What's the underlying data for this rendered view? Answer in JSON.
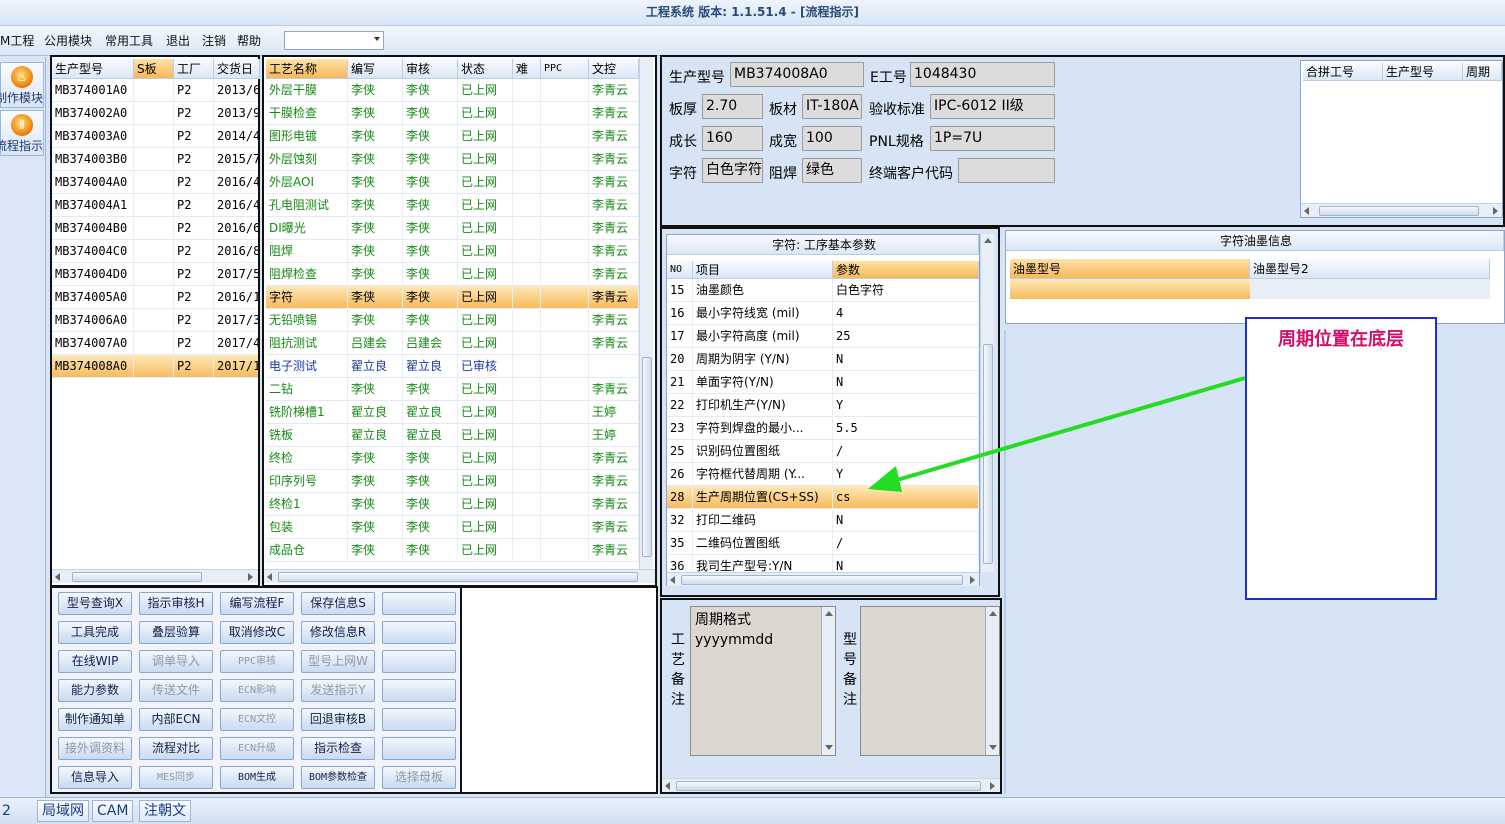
{
  "window": {
    "title": "工程系统  版本: 1.1.51.4 - [流程指示]"
  },
  "menu": {
    "items": [
      "M工程",
      "公用模块",
      "常用工具",
      "退出",
      "注销",
      "帮助"
    ],
    "combo_value": ""
  },
  "left_nav": {
    "items": [
      {
        "label": "制作模块",
        "icon": "fire-icon"
      },
      {
        "label": "流程指示",
        "icon": "process-icon"
      }
    ]
  },
  "product_grid": {
    "headers": [
      "生产型号",
      "S板",
      "工厂",
      "交货日"
    ],
    "rows": [
      {
        "model": "MB374001A0",
        "s": "",
        "factory": "P2",
        "date": "2013/6"
      },
      {
        "model": "MB374002A0",
        "s": "",
        "factory": "P2",
        "date": "2013/9"
      },
      {
        "model": "MB374003A0",
        "s": "",
        "factory": "P2",
        "date": "2014/4"
      },
      {
        "model": "MB374003B0",
        "s": "",
        "factory": "P2",
        "date": "2015/7"
      },
      {
        "model": "MB374004A0",
        "s": "",
        "factory": "P2",
        "date": "2016/4"
      },
      {
        "model": "MB374004A1",
        "s": "",
        "factory": "P2",
        "date": "2016/4"
      },
      {
        "model": "MB374004B0",
        "s": "",
        "factory": "P2",
        "date": "2016/6"
      },
      {
        "model": "MB374004C0",
        "s": "",
        "factory": "P2",
        "date": "2016/8"
      },
      {
        "model": "MB374004D0",
        "s": "",
        "factory": "P2",
        "date": "2017/5"
      },
      {
        "model": "MB374005A0",
        "s": "",
        "factory": "P2",
        "date": "2016/1"
      },
      {
        "model": "MB374006A0",
        "s": "",
        "factory": "P2",
        "date": "2017/3"
      },
      {
        "model": "MB374007A0",
        "s": "",
        "factory": "P2",
        "date": "2017/4"
      },
      {
        "model": "MB374008A0",
        "s": "",
        "factory": "P2",
        "date": "2017/1",
        "selected": true
      }
    ]
  },
  "process_grid": {
    "headers": [
      "工艺名称",
      "编写",
      "审核",
      "状态",
      "难",
      "PPC",
      "文控"
    ],
    "rows": [
      {
        "name": "外层干膜",
        "writer": "李侠",
        "reviewer": "李侠",
        "status": "已上网",
        "doc": "李青云"
      },
      {
        "name": "干膜检查",
        "writer": "李侠",
        "reviewer": "李侠",
        "status": "已上网",
        "doc": "李青云"
      },
      {
        "name": "图形电镀",
        "writer": "李侠",
        "reviewer": "李侠",
        "status": "已上网",
        "doc": "李青云"
      },
      {
        "name": "外层蚀刻",
        "writer": "李侠",
        "reviewer": "李侠",
        "status": "已上网",
        "doc": "李青云"
      },
      {
        "name": "外层AOI",
        "writer": "李侠",
        "reviewer": "李侠",
        "status": "已上网",
        "doc": "李青云"
      },
      {
        "name": "孔电阻测试",
        "writer": "李侠",
        "reviewer": "李侠",
        "status": "已上网",
        "doc": "李青云"
      },
      {
        "name": "DI曝光",
        "writer": "李侠",
        "reviewer": "李侠",
        "status": "已上网",
        "doc": "李青云"
      },
      {
        "name": "阻焊",
        "writer": "李侠",
        "reviewer": "李侠",
        "status": "已上网",
        "doc": "李青云"
      },
      {
        "name": "阻焊检查",
        "writer": "李侠",
        "reviewer": "李侠",
        "status": "已上网",
        "doc": "李青云"
      },
      {
        "name": "字符",
        "writer": "李侠",
        "reviewer": "李侠",
        "status": "已上网",
        "doc": "李青云",
        "selected": true
      },
      {
        "name": "无铅喷锡",
        "writer": "李侠",
        "reviewer": "李侠",
        "status": "已上网",
        "doc": "李青云"
      },
      {
        "name": "阻抗测试",
        "writer": "吕建会",
        "reviewer": "吕建会",
        "status": "已上网",
        "doc": "李青云"
      },
      {
        "name": "电子测试",
        "writer": "翟立良",
        "reviewer": "翟立良",
        "status": "已审核",
        "doc": "",
        "pending": true
      },
      {
        "name": "二钻",
        "writer": "李侠",
        "reviewer": "李侠",
        "status": "已上网",
        "doc": "李青云"
      },
      {
        "name": "铣阶梯槽1",
        "writer": "翟立良",
        "reviewer": "翟立良",
        "status": "已上网",
        "doc": "王婷"
      },
      {
        "name": "铣板",
        "writer": "翟立良",
        "reviewer": "翟立良",
        "status": "已上网",
        "doc": "王婷"
      },
      {
        "name": "终检",
        "writer": "李侠",
        "reviewer": "李侠",
        "status": "已上网",
        "doc": "李青云"
      },
      {
        "name": "印序列号",
        "writer": "李侠",
        "reviewer": "李侠",
        "status": "已上网",
        "doc": "李青云"
      },
      {
        "name": "终检1",
        "writer": "李侠",
        "reviewer": "李侠",
        "status": "已上网",
        "doc": "李青云"
      },
      {
        "name": "包装",
        "writer": "李侠",
        "reviewer": "李侠",
        "status": "已上网",
        "doc": "李青云"
      },
      {
        "name": "成品仓",
        "writer": "李侠",
        "reviewer": "李侠",
        "status": "已上网",
        "doc": "李青云"
      }
    ]
  },
  "buttons": [
    [
      {
        "label": "型号查询X",
        "enabled": true
      },
      {
        "label": "指示审核H",
        "enabled": true
      },
      {
        "label": "编写流程F",
        "enabled": true
      },
      {
        "label": "保存信息S",
        "enabled": true
      },
      {
        "label": "",
        "enabled": true
      }
    ],
    [
      {
        "label": "工具完成",
        "enabled": true
      },
      {
        "label": "叠层验算",
        "enabled": true
      },
      {
        "label": "取消修改C",
        "enabled": true
      },
      {
        "label": "修改信息R",
        "enabled": true
      },
      {
        "label": "",
        "enabled": true
      }
    ],
    [
      {
        "label": "在线WIP",
        "enabled": true
      },
      {
        "label": "调单导入",
        "enabled": false
      },
      {
        "label": "PPC审核",
        "enabled": false
      },
      {
        "label": "型号上网W",
        "enabled": false
      },
      {
        "label": "",
        "enabled": true
      }
    ],
    [
      {
        "label": "能力参数",
        "enabled": true
      },
      {
        "label": "传送文件",
        "enabled": false
      },
      {
        "label": "ECN影响",
        "enabled": false
      },
      {
        "label": "发送指示Y",
        "enabled": false
      },
      {
        "label": "",
        "enabled": true
      }
    ],
    [
      {
        "label": "制作通知单",
        "enabled": true
      },
      {
        "label": "内部ECN",
        "enabled": true
      },
      {
        "label": "ECN文控",
        "enabled": false
      },
      {
        "label": "回退审核B",
        "enabled": true
      },
      {
        "label": "",
        "enabled": true
      }
    ],
    [
      {
        "label": "接外调资料",
        "enabled": false
      },
      {
        "label": "流程对比",
        "enabled": true
      },
      {
        "label": "ECN升级",
        "enabled": false
      },
      {
        "label": "指示检查",
        "enabled": true
      },
      {
        "label": "",
        "enabled": true
      }
    ],
    [
      {
        "label": "信息导入",
        "enabled": true
      },
      {
        "label": "MES同步",
        "enabled": false
      },
      {
        "label": "BOM生成",
        "enabled": true
      },
      {
        "label": "BOM参数检查",
        "enabled": true
      },
      {
        "label": "选择母板",
        "enabled": false
      }
    ]
  ],
  "info": {
    "model_label": "生产型号",
    "model": "MB374008A0",
    "eno_label": "E工号",
    "eno": "1048430",
    "thickness_label": "板厚",
    "thickness": "2.70",
    "material_label": "板材",
    "material": "IT-180A",
    "standard_label": "验收标准",
    "standard": "IPC-6012 II级",
    "length_label": "成长",
    "length": "160",
    "width_label": "成宽",
    "width": "100",
    "pnl_label": "PNL规格",
    "pnl": "1P=7U",
    "char_label": "字符",
    "char": "白色字符",
    "mask_label": "阻焊",
    "mask": "绿色",
    "customer_label": "终端客户代码",
    "customer": ""
  },
  "merge_grid": {
    "headers": [
      "合拼工号",
      "生产型号",
      "周期"
    ]
  },
  "params": {
    "title": "字符: 工序基本参数",
    "headers": [
      "NO",
      "项目",
      "参数"
    ],
    "rows": [
      {
        "no": "15",
        "item": "油墨颜色",
        "value": "白色字符"
      },
      {
        "no": "16",
        "item": "最小字符线宽 (mil)",
        "value": "4"
      },
      {
        "no": "17",
        "item": "最小字符高度 (mil)",
        "value": "25"
      },
      {
        "no": "20",
        "item": "周期为阴字 (Y/N)",
        "value": "N"
      },
      {
        "no": "21",
        "item": "单面字符(Y/N)",
        "value": "N"
      },
      {
        "no": "22",
        "item": "打印机生产(Y/N)",
        "value": "Y"
      },
      {
        "no": "23",
        "item": "字符到焊盘的最小...",
        "value": "5.5"
      },
      {
        "no": "25",
        "item": "识别码位置图纸",
        "value": "/"
      },
      {
        "no": "26",
        "item": "字符框代替周期 (Y...",
        "value": "Y"
      },
      {
        "no": "28",
        "item": "生产周期位置(CS+SS)",
        "value": "cs",
        "selected": true
      },
      {
        "no": "32",
        "item": "打印二维码",
        "value": "N"
      },
      {
        "no": "35",
        "item": "二维码位置图纸",
        "value": "/"
      },
      {
        "no": "36",
        "item": "我司生产型号:Y/N",
        "value": "N"
      }
    ]
  },
  "ink": {
    "title": "字符油墨信息",
    "headers": [
      "油墨型号",
      "油墨型号2"
    ]
  },
  "memo": {
    "process_label": [
      "工",
      "艺",
      "备",
      "注"
    ],
    "process_text": [
      "周期格式",
      "yyyymmdd"
    ],
    "model_label": [
      "型",
      "号",
      "备",
      "注"
    ],
    "model_text": ""
  },
  "annotation": {
    "text": "周期位置在底层",
    "arrow_color": "#22dd22",
    "box_border": "#1f2fc8",
    "text_color": "#d0106a"
  },
  "statusbar": {
    "num": "2",
    "tabs": [
      "局域网",
      "CAM",
      "注朝文"
    ]
  }
}
